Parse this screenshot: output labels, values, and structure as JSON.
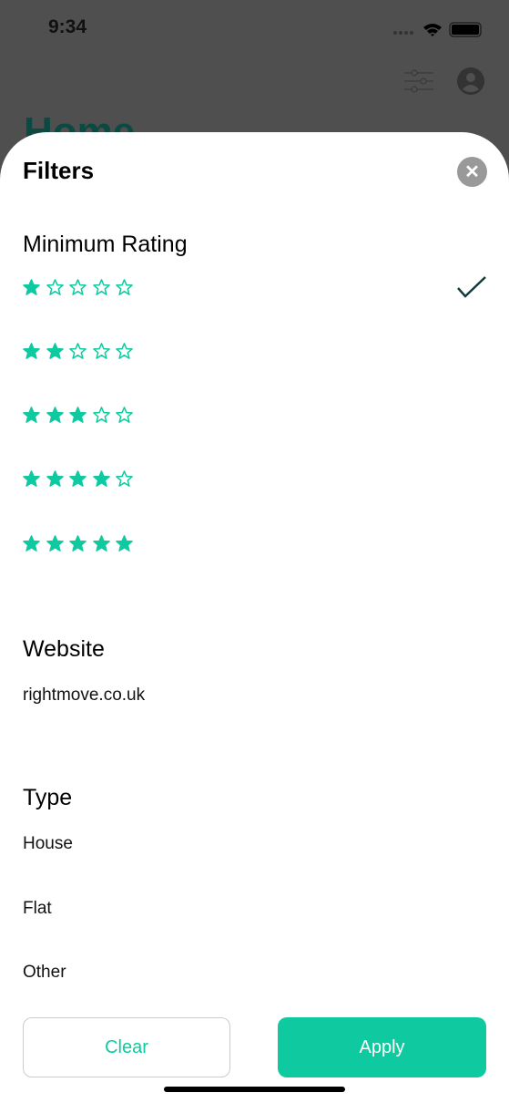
{
  "status": {
    "time": "9:34"
  },
  "background": {
    "title": "Home",
    "accent": "#0b4a42"
  },
  "sheet": {
    "title": "Filters",
    "rating": {
      "heading": "Minimum Rating",
      "options": [
        1,
        2,
        3,
        4,
        5
      ],
      "max": 5,
      "selected": 1,
      "star_color": "#0fcaa0"
    },
    "website": {
      "heading": "Website",
      "options": [
        "rightmove.co.uk"
      ]
    },
    "type": {
      "heading": "Type",
      "options": [
        "House",
        "Flat",
        "Other"
      ]
    },
    "clear_label": "Clear",
    "apply_label": "Apply",
    "accent": "#0fcaa0"
  }
}
